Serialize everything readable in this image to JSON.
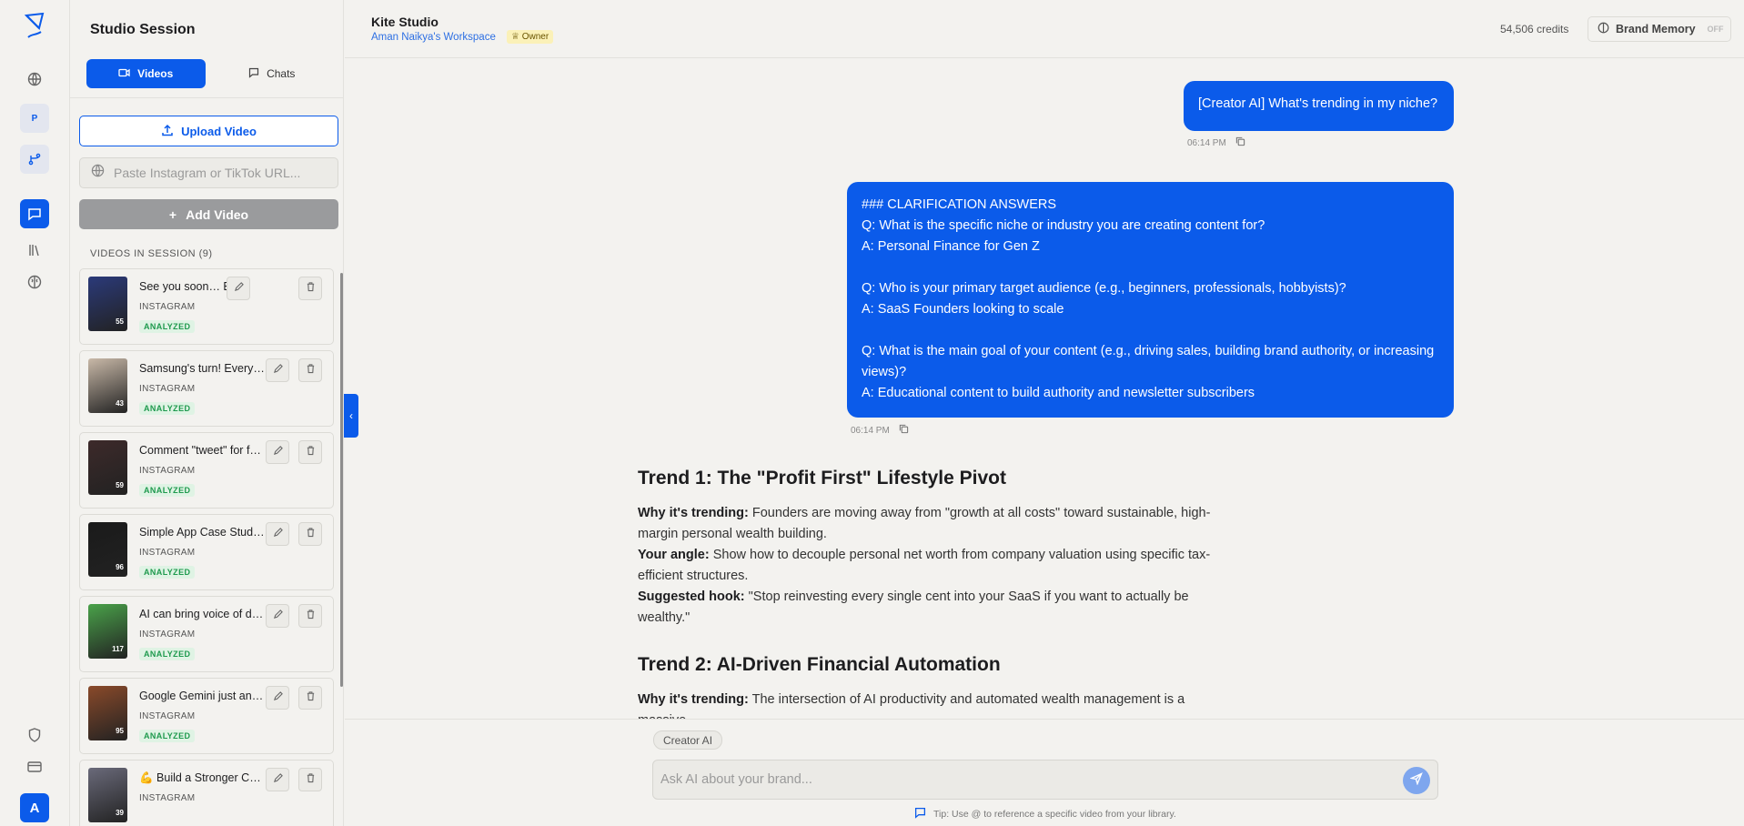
{
  "sidebar": {
    "title": "Studio Session",
    "tabs": [
      {
        "label": "Videos",
        "active": true
      },
      {
        "label": "Chats",
        "active": false
      }
    ],
    "upload_label": "Upload Video",
    "url_placeholder": "Paste Instagram or TikTok URL...",
    "add_label": "Add Video",
    "section_label": "VIDEOS IN SESSION (9)",
    "videos": [
      {
        "title": "See you soon… ET",
        "platform": "INSTAGRAM",
        "status": "ANALYZED",
        "count": "55",
        "thumb_color": "#2b3a7a"
      },
      {
        "title": "Samsung's turn! Every …",
        "platform": "INSTAGRAM",
        "status": "ANALYZED",
        "count": "43",
        "thumb_color": "#c9b9a8"
      },
      {
        "title": "Comment \"tweet\" for f…",
        "platform": "INSTAGRAM",
        "status": "ANALYZED",
        "count": "59",
        "thumb_color": "#3d2a2a"
      },
      {
        "title": "Simple App Case Study…",
        "platform": "INSTAGRAM",
        "status": "ANALYZED",
        "count": "96",
        "thumb_color": "#1a1a1a"
      },
      {
        "title": "AI can bring voice of de…",
        "platform": "INSTAGRAM",
        "status": "ANALYZED",
        "count": "117",
        "thumb_color": "#4aa24a"
      },
      {
        "title": "Google Gemini just ann…",
        "platform": "INSTAGRAM",
        "status": "ANALYZED",
        "count": "95",
        "thumb_color": "#8a4a2a"
      },
      {
        "title": "💪 Build a Stronger Ch…",
        "platform": "INSTAGRAM",
        "status": "",
        "count": "39",
        "thumb_color": "#6a6a7a"
      }
    ]
  },
  "header": {
    "title": "Kite Studio",
    "workspace": "Aman Naikya's Workspace",
    "role": "Owner",
    "credits": "54,506 credits",
    "brand_memory_label": "Brand Memory",
    "brand_memory_state": "OFF"
  },
  "chat": {
    "user_messages": [
      {
        "lines": [
          "[Creator AI] What's trending in my niche?"
        ],
        "time": "06:14 PM"
      },
      {
        "lines": [
          "### CLARIFICATION ANSWERS",
          "Q: What is the specific niche or industry you are creating content for?",
          "A: Personal Finance for Gen Z",
          "",
          "Q: Who is your primary target audience (e.g., beginners, professionals, hobbyists)?",
          "A: SaaS Founders looking to scale",
          "",
          "Q: What is the main goal of your content (e.g., driving sales, building brand authority, or increasing views)?",
          "A: Educational content to build authority and newsletter subscribers"
        ],
        "time": "06:14 PM"
      }
    ],
    "trends": [
      {
        "heading": "Trend 1: The \"Profit First\" Lifestyle Pivot",
        "why_label": "Why it's trending:",
        "why": "Founders are moving away from \"growth at all costs\" toward sustainable, high-margin personal wealth building.",
        "angle_label": "Your angle:",
        "angle": "Show how to decouple personal net worth from company valuation using specific tax-efficient structures.",
        "hook_label": "Suggested hook:",
        "hook": "\"Stop reinvesting every single cent into your SaaS if you want to actually be wealthy.\""
      },
      {
        "heading": "Trend 2: AI-Driven Financial Automation",
        "why_label": "Why it's trending:",
        "why": "The intersection of AI productivity and automated wealth management is a massive"
      }
    ]
  },
  "composer": {
    "chip": "Creator AI",
    "placeholder": "Ask AI about your brand...",
    "tip": "Tip: Use @ to reference a specific video from your library."
  }
}
